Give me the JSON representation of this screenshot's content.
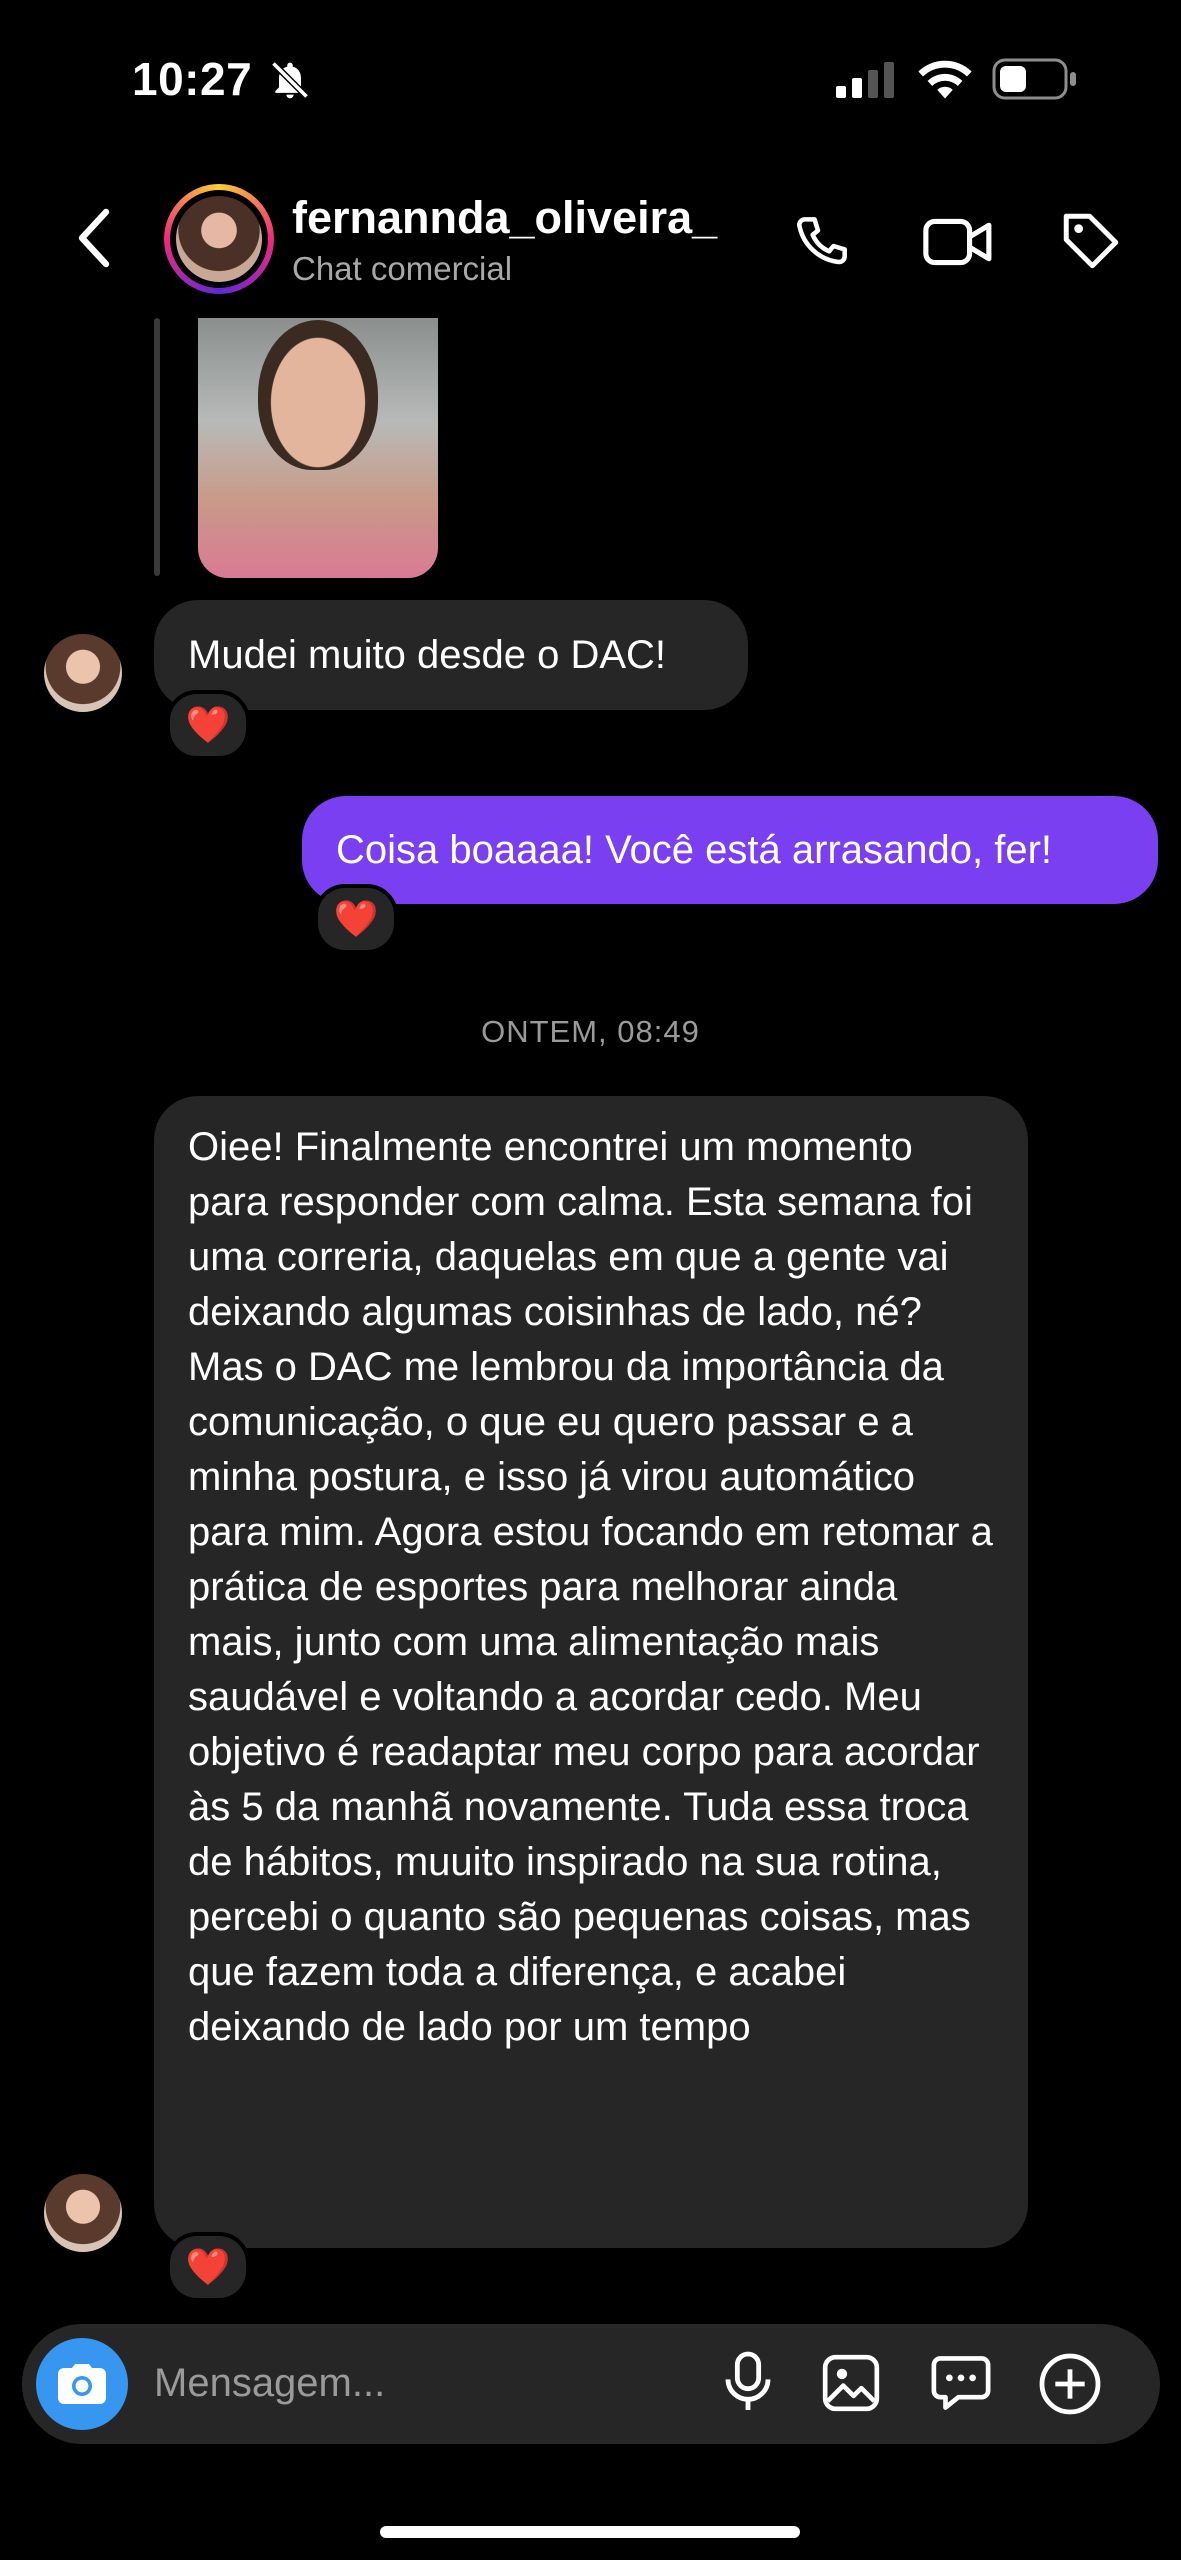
{
  "status_bar": {
    "time": "10:27"
  },
  "header": {
    "username": "fernannda_oliveira_",
    "subtitle": "Chat comercial"
  },
  "messages": [
    {
      "direction": "incoming",
      "text": "Mudei muito desde o DAC!",
      "reaction": "❤️"
    },
    {
      "direction": "outgoing",
      "text": "Coisa boaaaa! Você está arrasando, fer!",
      "reaction": "❤️"
    },
    {
      "direction": "incoming",
      "text": "Oiee! Finalmente encontrei um momento para responder com calma. Esta semana foi uma correria, daquelas em que a gente vai deixando algumas coisinhas de lado, né? Mas o DAC me lembrou da importância da comunicação, o que eu quero passar e a minha postura, e isso já virou automático para mim. Agora estou focando em retomar a prática de esportes para melhorar ainda mais, junto com uma alimentação mais saudável e voltando a acordar cedo. Meu objetivo é readaptar meu corpo para acordar às 5 da manhã novamente. Tuda essa troca de hábitos, muuito inspirado na sua rotina, percebi o quanto são pequenas coisas, mas que fazem toda a diferença, e acabei deixando de lado por um tempo",
      "reaction": "❤️"
    }
  ],
  "timestamp": "ONTEM, 08:49",
  "composer": {
    "placeholder": "Mensagem..."
  },
  "colors": {
    "outgoing_bubble": "#7b3ff2",
    "incoming_bubble": "#262626",
    "camera_button": "#3797f0"
  }
}
